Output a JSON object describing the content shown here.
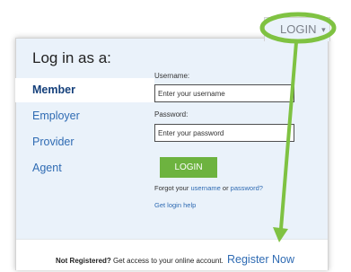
{
  "login_tab": {
    "label": "LOGIN",
    "caret": "▾"
  },
  "form": {
    "title": "Log in as a:",
    "roles": [
      {
        "label": "Member",
        "selected": true
      },
      {
        "label": "Employer",
        "selected": false
      },
      {
        "label": "Provider",
        "selected": false
      },
      {
        "label": "Agent",
        "selected": false
      }
    ],
    "username_label": "Username:",
    "username_placeholder": "Enter your username",
    "password_label": "Password:",
    "password_placeholder": "Enter your password",
    "submit_label": "LOGIN",
    "forgot_prefix": "Forgot your",
    "forgot_username": "username",
    "forgot_or": "or",
    "forgot_password": "password?",
    "help_link": "Get login help"
  },
  "footer": {
    "not_registered": "Not Registered?",
    "message": "Get access to your online account.",
    "register_link": "Register Now"
  },
  "annotation": {
    "color": "#7fc242"
  }
}
